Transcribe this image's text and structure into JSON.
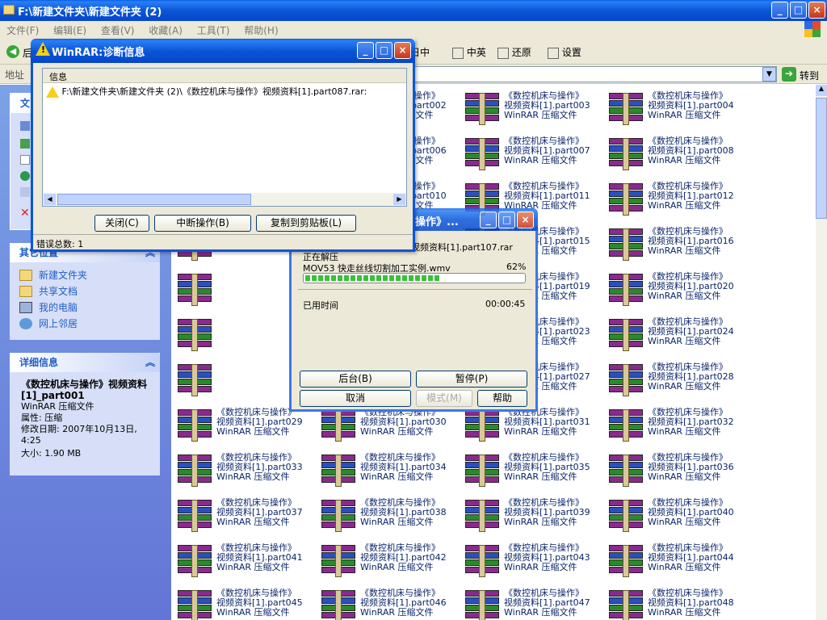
{
  "window": {
    "title": "F:\\新建文件夹\\新建文件夹 (2)"
  },
  "menu": [
    "文件(F)",
    "编辑(E)",
    "查看(V)",
    "收藏(A)",
    "工具(T)",
    "帮助(H)"
  ],
  "toolbar": {
    "back": "后",
    "day": "日中",
    "cn": "中英",
    "restore": "还原",
    "settings": "设置"
  },
  "address": {
    "label": "地址",
    "go": "转到"
  },
  "left": {
    "cut_letter": "文",
    "other_places": {
      "title": "其它位置",
      "items": [
        "新建文件夹",
        "共享文档",
        "我的电脑",
        "网上邻居"
      ]
    },
    "details": {
      "title": "详细信息",
      "name": "《数控机床与操作》视频资料[1]_part001",
      "type": "WinRAR 压缩文件",
      "attr": "属性: 压缩",
      "modified": "修改日期: 2007年10月13日, 4:25",
      "size": "大小: 1.90 MB"
    }
  },
  "files": {
    "prefix": "《数控机床与操作》",
    "mid": "视频资料[1].part",
    "type": "WinRAR 压缩文件",
    "items": [
      "002",
      "003",
      "004",
      "006",
      "007",
      "008",
      "010",
      "011",
      "012",
      "015",
      "016",
      "019",
      "020",
      "023",
      "024",
      "027",
      "028",
      "029",
      "030",
      "031",
      "032",
      "033",
      "034",
      "035",
      "036",
      "037",
      "038",
      "039",
      "040",
      "041",
      "042",
      "043",
      "044",
      "045",
      "046",
      "047",
      "048"
    ]
  },
  "diag": {
    "title": "WinRAR:诊断信息",
    "header": "信息",
    "msg": "F:\\新建文件夹\\新建文件夹 (2)\\《数控机床与操作》视频资料[1].part087.rar:",
    "close": "关闭(C)",
    "break": "中断操作(B)",
    "copy": "复制到剪贴板(L)",
    "errors": "错误总数: 1"
  },
  "extract": {
    "title": "操作》...",
    "archive": "视频资料[1].part107.rar",
    "status": "正在解压",
    "file": "MOV53 快走丝线切割加工实例.wmv",
    "percent": "62%",
    "progress": 0.62,
    "elapsed_label": "已用时间",
    "elapsed": "00:00:45",
    "bg": "后台(B)",
    "pause": "暂停(P)",
    "cancel": "取消",
    "mode": "模式(M)",
    "help": "帮助"
  }
}
